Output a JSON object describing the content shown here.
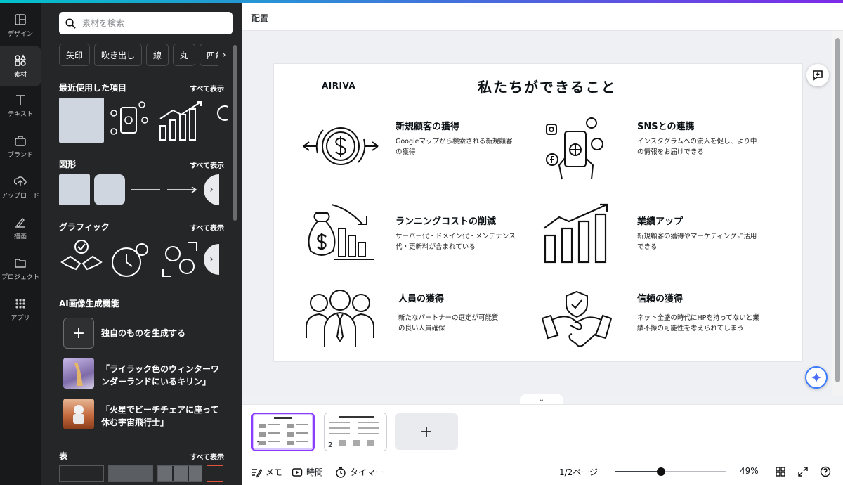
{
  "rail": [
    {
      "label": "デザイン",
      "icon": "layout-icon"
    },
    {
      "label": "素材",
      "icon": "elements-icon"
    },
    {
      "label": "テキスト",
      "icon": "text-icon"
    },
    {
      "label": "ブランド",
      "icon": "brand-icon"
    },
    {
      "label": "アップロード",
      "icon": "upload-icon"
    },
    {
      "label": "描画",
      "icon": "draw-icon"
    },
    {
      "label": "プロジェクト",
      "icon": "folder-icon"
    },
    {
      "label": "アプリ",
      "icon": "apps-icon"
    }
  ],
  "panel": {
    "search_placeholder": "素材を検索",
    "chips": [
      "矢印",
      "吹き出し",
      "線",
      "丸",
      "四角"
    ],
    "recent": {
      "title": "最近使用した項目",
      "all": "すべて表示"
    },
    "shapes": {
      "title": "図形",
      "all": "すべて表示"
    },
    "graphics": {
      "title": "グラフィック",
      "all": "すべて表示"
    },
    "ai": {
      "title": "AI画像生成機能",
      "generate": "独自のものを生成する",
      "example1": "「ライラック色のウィンターワンダーランドにいるキリン」",
      "example2": "「火星でビーチチェアに座って休む宇宙飛行士」"
    },
    "table": {
      "title": "表",
      "all": "すべて表示"
    }
  },
  "header": {
    "title": "配置"
  },
  "slide": {
    "logo": "AIRIVA",
    "title": "私たちができること",
    "features": [
      {
        "title": "新規顧客の獲得",
        "desc": "Googleマップから検索される新規顧客の獲得"
      },
      {
        "title": "SNSとの連携",
        "desc": "インスタグラムへの流入を促し、より中の情報をお届けできる"
      },
      {
        "title": "ランニングコストの削減",
        "desc": "サーバー代・ドメイン代・メンテナンス代・更新料が含まれている"
      },
      {
        "title": "業績アップ",
        "desc": "新規顧客の獲得やマーケティングに活用できる"
      },
      {
        "title": "人員の獲得",
        "desc": "新たなパートナーの選定が可能質の良い人員確保"
      },
      {
        "title": "信頼の獲得",
        "desc": "ネット全盛の時代にHPを持ってないと業績不振の可能性を考えられてしまう"
      }
    ]
  },
  "pages": [
    {
      "num": "1"
    },
    {
      "num": "2"
    }
  ],
  "footer": {
    "notes": "メモ",
    "duration": "時間",
    "timer": "タイマー",
    "page_indicator": "1/2ページ",
    "zoom": "49%",
    "zoom_level": 0.49
  },
  "colors": {
    "accent": "#8b3dff",
    "panel": "#252627",
    "rail": "#18191b"
  }
}
